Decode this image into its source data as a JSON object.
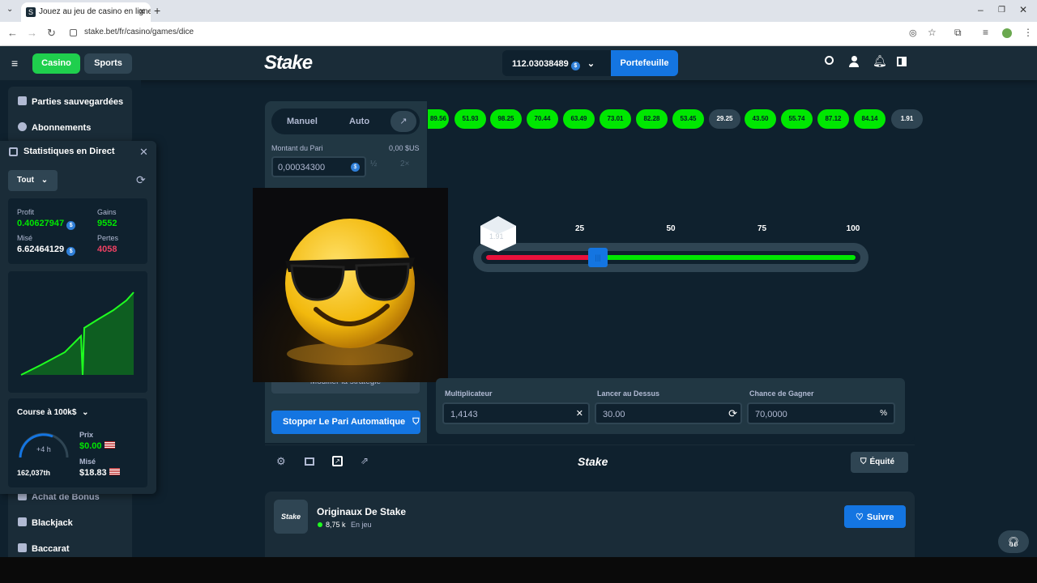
{
  "browser": {
    "tab_title": "Jouez au jeu de casino en ligne",
    "tab_favicon": "S",
    "url": "stake.bet/fr/casino/games/dice"
  },
  "header": {
    "casino": "Casino",
    "sports": "Sports",
    "logo": "Stake",
    "balance": "112.03038489",
    "wallet": "Portefeuille"
  },
  "sidebar": {
    "saved": "Parties sauvegardées",
    "subscriptions": "Abonnements",
    "bonus": "Achat de Bonus",
    "blackjack": "Blackjack",
    "baccarat": "Baccarat"
  },
  "stats": {
    "title": "Statistiques en Direct",
    "filter": "Tout",
    "profit_label": "Profit",
    "profit": "0.40627947",
    "wins_label": "Gains",
    "wins": "9552",
    "wagered_label": "Misé",
    "wagered": "6.62464129",
    "losses_label": "Pertes",
    "losses": "4058",
    "race_title": "Course à 100k$",
    "race_timer": "+4 h",
    "race_rank": "162,037th",
    "prize_label": "Prix",
    "prize": "$0.00",
    "race_wagered_label": "Misé",
    "race_wagered": "$18.83"
  },
  "game": {
    "tab_manual": "Manuel",
    "tab_auto": "Auto",
    "bet_label": "Montant du Pari",
    "bet_usd": "0,00 $US",
    "bet_value": "0,00034300",
    "half": "½",
    "double": "2×",
    "strategy": "Modifier la stratégie",
    "stop_button": "Stopper Le Pari Automatique",
    "history": [
      "89.56",
      "51.93",
      "98.25",
      "70.44",
      "63.49",
      "73.01",
      "82.28",
      "53.45",
      "29.25",
      "43.50",
      "55.74",
      "87.12",
      "84.14",
      "1.91"
    ],
    "history_loss": [
      false,
      false,
      false,
      false,
      false,
      false,
      false,
      false,
      true,
      false,
      false,
      false,
      false,
      true
    ],
    "ticks": [
      "25",
      "50",
      "75",
      "100"
    ],
    "die_value": "1.91",
    "slider_value": 30,
    "multiplier_label": "Multiplicateur",
    "multiplier": "1,4143",
    "roll_over_label": "Lancer au Dessus",
    "roll_over": "30.00",
    "win_chance_label": "Chance de Gagner",
    "win_chance": "70,0000",
    "fairness": "Équité",
    "footer_logo": "Stake"
  },
  "originals": {
    "logo": "Stake",
    "title": "Originaux De Stake",
    "players": "8,75 k",
    "playing": "En jeu",
    "follow": "Suivre"
  },
  "colors": {
    "green": "#00e701",
    "red": "#e9113c",
    "blue": "#1475e1",
    "bg": "#0f212e"
  }
}
